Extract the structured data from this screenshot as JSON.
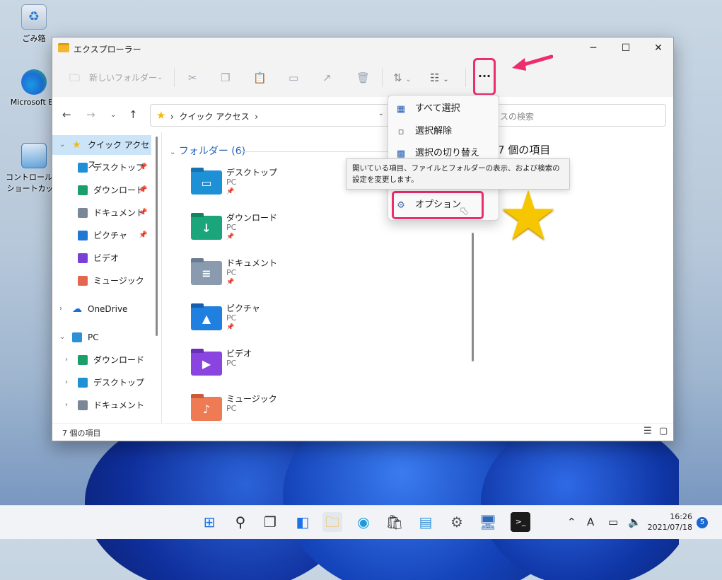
{
  "desktop": {
    "icons": [
      {
        "label": "ごみ箱",
        "icon": "recycle-bin-icon"
      },
      {
        "label": "Microsoft Ec",
        "icon": "edge-icon"
      },
      {
        "label": "コントロール パネ",
        "label2": "ショートカット",
        "icon": "control-panel-icon"
      }
    ]
  },
  "window": {
    "title": "エクスプローラー",
    "toolbar": {
      "new_folder_label": "新しいフォルダー",
      "more_label": "..."
    },
    "address": {
      "crumb": "クイック アクセス",
      "search_placeholder": "スの検索"
    },
    "nav": [
      {
        "label": "クイック アクセス",
        "icon": "star-icon",
        "color": "#f2b90c",
        "selected": true,
        "level": 0,
        "expanded": true
      },
      {
        "label": "デスクトップ",
        "icon": "desktop-icon",
        "color": "#1e91d6",
        "pinned": true,
        "level": 1
      },
      {
        "label": "ダウンロード",
        "icon": "download-icon",
        "color": "#1a9e6a",
        "pinned": true,
        "level": 1
      },
      {
        "label": "ドキュメント",
        "icon": "document-icon",
        "color": "#7a8796",
        "pinned": true,
        "level": 1
      },
      {
        "label": "ピクチャ",
        "icon": "picture-icon",
        "color": "#1f78d1",
        "pinned": true,
        "level": 1
      },
      {
        "label": "ビデオ",
        "icon": "video-icon",
        "color": "#7b3fd6",
        "level": 1
      },
      {
        "label": "ミュージック",
        "icon": "music-icon",
        "color": "#e2674d",
        "level": 1
      },
      {
        "label": "OneDrive",
        "icon": "cloud-icon",
        "color": "#1a6fd1",
        "level": 0
      },
      {
        "label": "PC",
        "icon": "pc-icon",
        "color": "#2d8fd6",
        "level": 0,
        "expanded": true
      },
      {
        "label": "ダウンロード",
        "icon": "download-icon",
        "color": "#1a9e6a",
        "level": 1,
        "child": true
      },
      {
        "label": "デスクトップ",
        "icon": "desktop-icon",
        "color": "#1e91d6",
        "level": 1,
        "child": true
      },
      {
        "label": "ドキュメント",
        "icon": "document-icon",
        "color": "#7a8796",
        "level": 1,
        "child": true
      }
    ],
    "group_title": "フォルダー (6)",
    "folders": [
      {
        "name": "デスクトップ",
        "sub": "PC",
        "pinned": true,
        "color": "#1e91d6",
        "tab": "#1872b0",
        "glyph": "▭"
      },
      {
        "name": "ダウンロード",
        "sub": "PC",
        "pinned": true,
        "color": "#1aa67a",
        "tab": "#128460",
        "glyph": "↓"
      },
      {
        "name": "ドキュメント",
        "sub": "PC",
        "pinned": true,
        "color": "#8a9bb0",
        "tab": "#6c7c90",
        "glyph": "≡"
      },
      {
        "name": "ピクチャ",
        "sub": "PC",
        "pinned": true,
        "color": "#1f80e0",
        "tab": "#165fae",
        "glyph": "▲"
      },
      {
        "name": "ビデオ",
        "sub": "PC",
        "pinned": false,
        "color": "#8a44e0",
        "tab": "#6a2fb8",
        "glyph": "▶"
      },
      {
        "name": "ミュージック",
        "sub": "PC",
        "pinned": false,
        "color": "#ef7b55",
        "tab": "#c95a3a",
        "glyph": "♪"
      }
    ],
    "details_count": "7 個の項目",
    "status": "7 個の項目"
  },
  "menu": {
    "items": [
      {
        "label": "すべて選択",
        "icon": "select-all-icon"
      },
      {
        "label": "選択解除",
        "icon": "select-none-icon"
      },
      {
        "label": "選択の切り替え",
        "icon": "invert-selection-icon"
      },
      {
        "label": "オプション",
        "icon": "options-icon"
      }
    ],
    "tooltip": "開いている項目、ファイルとフォルダーの表示、および検索の設定を変更します。"
  },
  "taskbar": {
    "time": "16:26",
    "date": "2021/07/18",
    "notification_count": "5",
    "ime": "A"
  },
  "colors": {
    "highlight": "#ec2d6f",
    "accent": "#2a63b8"
  }
}
